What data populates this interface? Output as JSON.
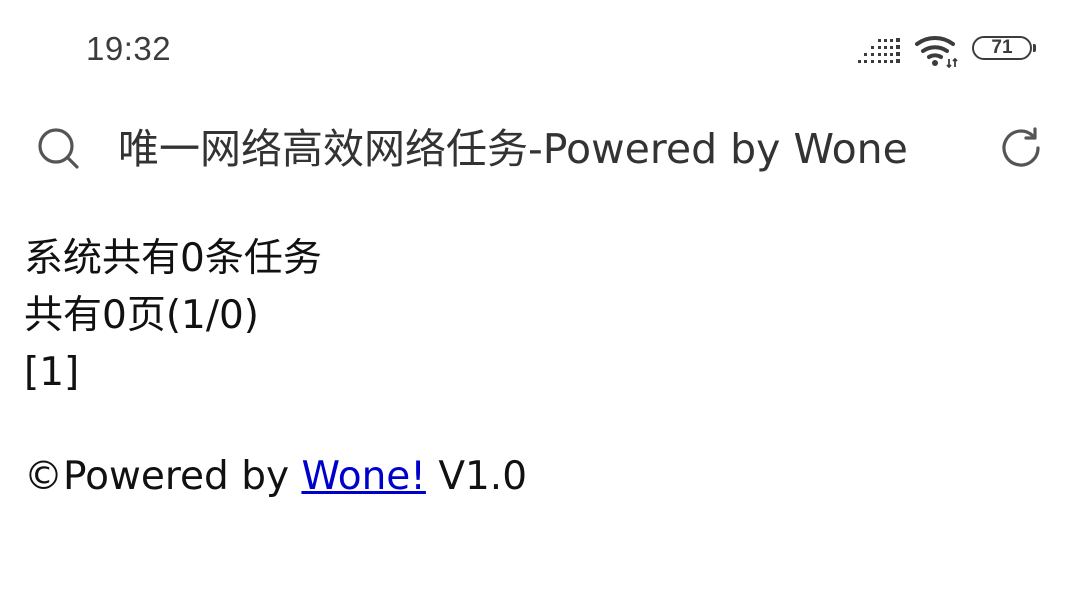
{
  "status_bar": {
    "time": "19:32",
    "battery_level": "71",
    "icons": [
      "signal-icon",
      "wifi-icon",
      "battery-icon"
    ]
  },
  "address_bar": {
    "title": "唯一网络高效网络任务-Powered by Wone",
    "icons": [
      "search-icon",
      "reload-icon"
    ]
  },
  "content": {
    "task_count": "系统共有0条任务",
    "page_info": "共有0页(1/0)",
    "page_link": "[1]"
  },
  "footer": {
    "prefix": "©Powered by ",
    "link_text": "Wone!",
    "suffix": " V1.0",
    "link_color": "#0000cc"
  }
}
